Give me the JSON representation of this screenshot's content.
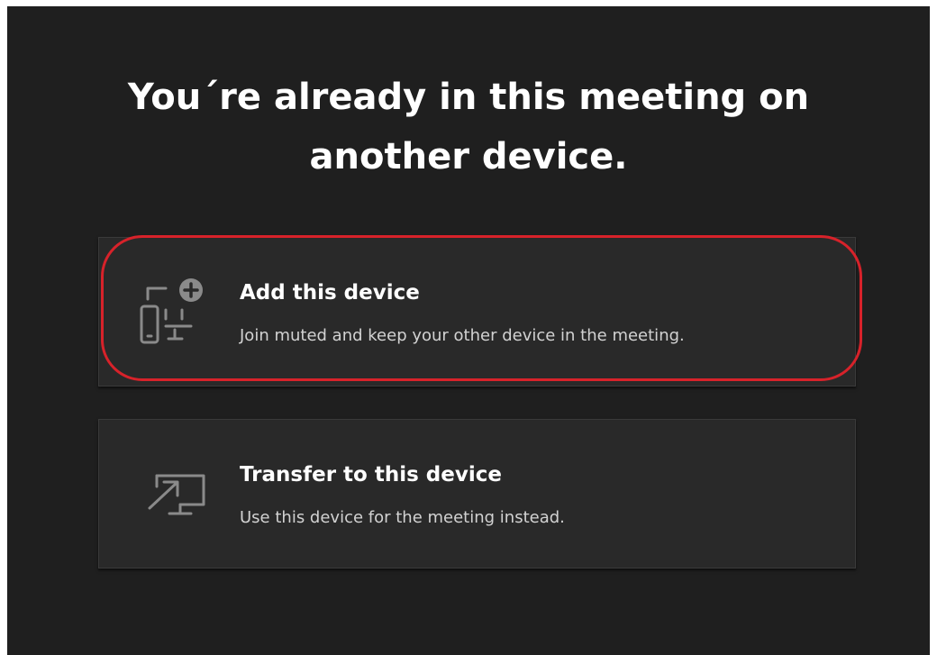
{
  "dialog": {
    "title_line1": "You´re already in this meeting on",
    "title_line2": "another device."
  },
  "options": [
    {
      "title": "Add this device",
      "description": "Join muted and keep your other device in the meeting.",
      "icon": "add-device-icon",
      "highlighted": true
    },
    {
      "title": "Transfer to this device",
      "description": "Use this device for the meeting instead.",
      "icon": "transfer-screen-icon",
      "highlighted": false
    }
  ],
  "colors": {
    "background": "#1f1f1f",
    "card": "#292929",
    "highlight": "#d7222a",
    "icon": "#8a8a8a"
  }
}
